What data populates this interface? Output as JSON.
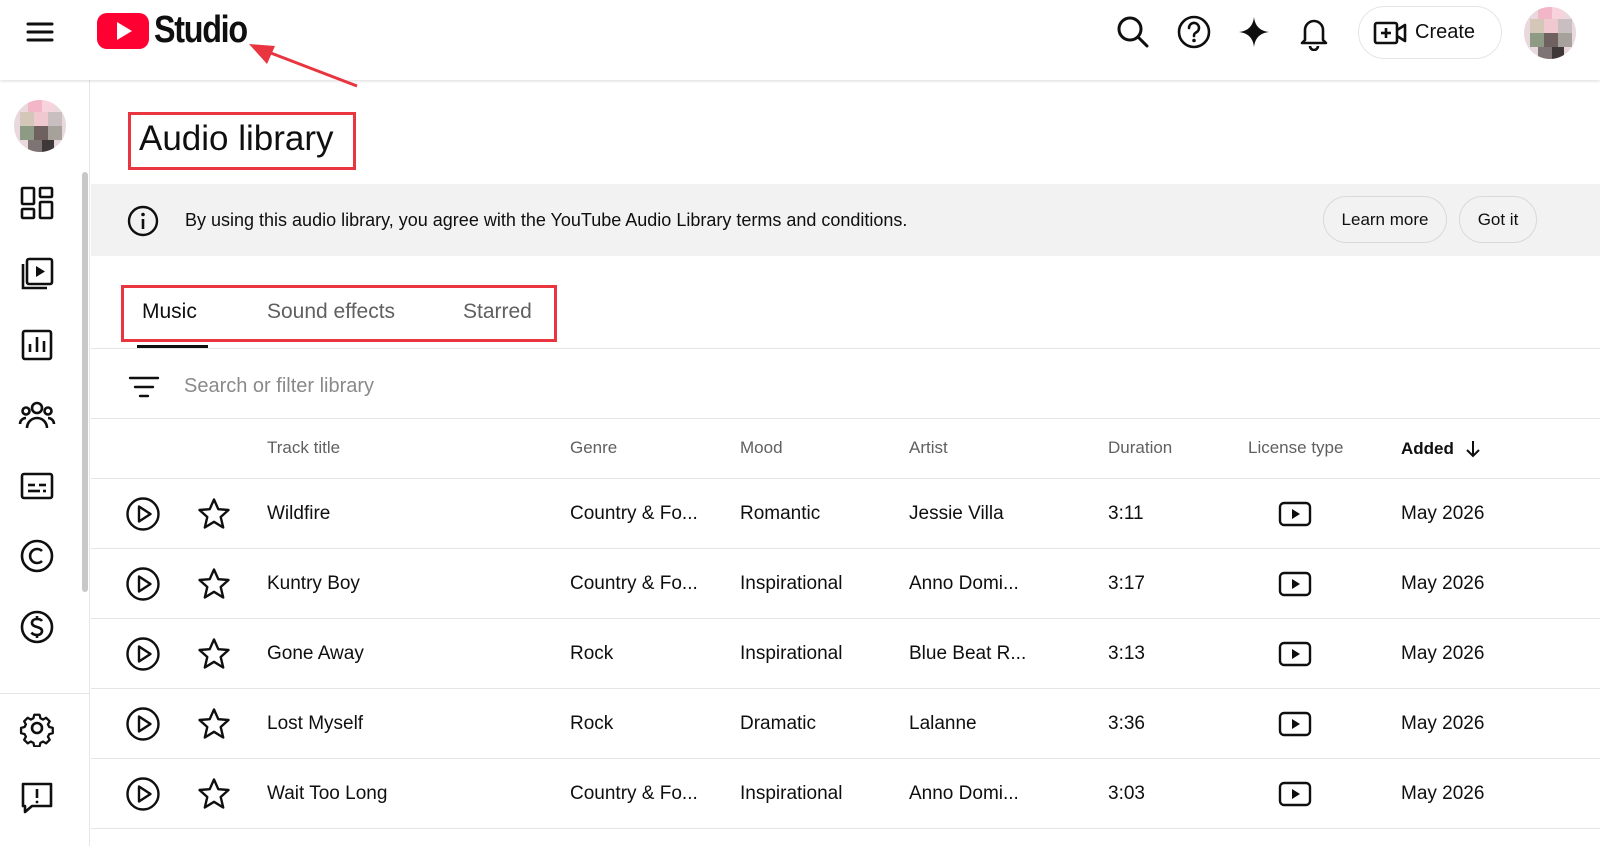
{
  "header": {
    "logo_text": "Studio",
    "create_label": "Create"
  },
  "page": {
    "title": "Audio library"
  },
  "banner": {
    "message": "By using this audio library, you agree with the YouTube Audio Library terms and conditions.",
    "learn_more": "Learn more",
    "got_it": "Got it"
  },
  "tabs": [
    {
      "label": "Music",
      "active": true
    },
    {
      "label": "Sound effects",
      "active": false
    },
    {
      "label": "Starred",
      "active": false
    }
  ],
  "search": {
    "placeholder": "Search or filter library"
  },
  "table": {
    "headers": {
      "track_title": "Track title",
      "genre": "Genre",
      "mood": "Mood",
      "artist": "Artist",
      "duration": "Duration",
      "license_type": "License type",
      "added": "Added"
    },
    "rows": [
      {
        "title": "Wildfire",
        "genre": "Country & Fo...",
        "mood": "Romantic",
        "artist": "Jessie Villa",
        "duration": "3:11",
        "added": "May 2026"
      },
      {
        "title": "Kuntry Boy",
        "genre": "Country & Fo...",
        "mood": "Inspirational",
        "artist": "Anno Domi...",
        "duration": "3:17",
        "added": "May 2026"
      },
      {
        "title": "Gone Away",
        "genre": "Rock",
        "mood": "Inspirational",
        "artist": "Blue Beat R...",
        "duration": "3:13",
        "added": "May 2026"
      },
      {
        "title": "Lost Myself",
        "genre": "Rock",
        "mood": "Dramatic",
        "artist": "Lalanne",
        "duration": "3:36",
        "added": "May 2026"
      },
      {
        "title": "Wait Too Long",
        "genre": "Country & Fo...",
        "mood": "Inspirational",
        "artist": "Anno Domi...",
        "duration": "3:03",
        "added": "May 2026"
      }
    ]
  },
  "colors": {
    "brand_red": "#ff0033",
    "annotation_red": "#e8353f"
  }
}
